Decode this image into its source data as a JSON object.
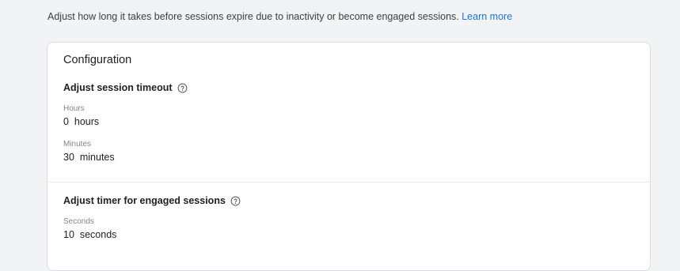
{
  "intro": {
    "text": "Adjust how long it takes before sessions expire due to inactivity or become engaged sessions.",
    "link_label": "Learn more"
  },
  "card": {
    "title": "Configuration",
    "session_timeout": {
      "heading": "Adjust session timeout",
      "hours_label": "Hours",
      "hours_value": "0  hours",
      "minutes_label": "Minutes",
      "minutes_value": "30  minutes"
    },
    "engaged_timer": {
      "heading": "Adjust timer for engaged sessions",
      "seconds_label": "Seconds",
      "seconds_value": "10  seconds"
    }
  },
  "icons": {
    "help": "help-circle-icon"
  },
  "colors": {
    "background": "#f1f3f4",
    "link": "#1a73e8",
    "card": "#ffffff",
    "border": "#dadce0",
    "muted_label": "#80868b"
  }
}
